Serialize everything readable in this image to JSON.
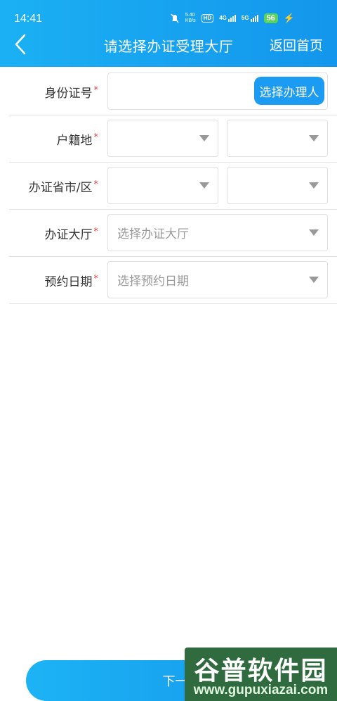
{
  "status_bar": {
    "time": "14:41",
    "speed_value": "5.40",
    "speed_unit": "KB/s",
    "hd_label": "HD",
    "sig1_label": "4G",
    "sig2_label": "5G",
    "battery": "56",
    "icons": [
      "mute-icon",
      "hd-icon",
      "signal-4g-icon",
      "signal-5g-icon",
      "battery-icon",
      "charging-icon"
    ]
  },
  "header": {
    "title": "请选择办证受理大厅",
    "home_link": "返回首页",
    "back_icon": "chevron-left-icon"
  },
  "form": {
    "id_number": {
      "label": "身份证号",
      "required_mark": "*",
      "value": "",
      "button": "选择办理人"
    },
    "household": {
      "label": "户籍地",
      "required_mark": "*",
      "province": "",
      "city": ""
    },
    "office_region": {
      "label": "办证省市/区",
      "required_mark": "*",
      "province": "",
      "city": ""
    },
    "office_hall": {
      "label": "办证大厅",
      "required_mark": "*",
      "placeholder": "选择办证大厅"
    },
    "appointment_date": {
      "label": "预约日期",
      "required_mark": "*",
      "placeholder": "选择预约日期"
    }
  },
  "footer": {
    "next_button": "下一步"
  },
  "watermark": {
    "brand": "谷普软件园",
    "url": "www.gupuxiazai.com"
  },
  "colors": {
    "primary": "#1b9cf2",
    "header_gradient_start": "#1bb0f3",
    "header_gradient_end": "#1396ec",
    "required": "#e54545",
    "watermark_bg": "#2f6b3e"
  }
}
